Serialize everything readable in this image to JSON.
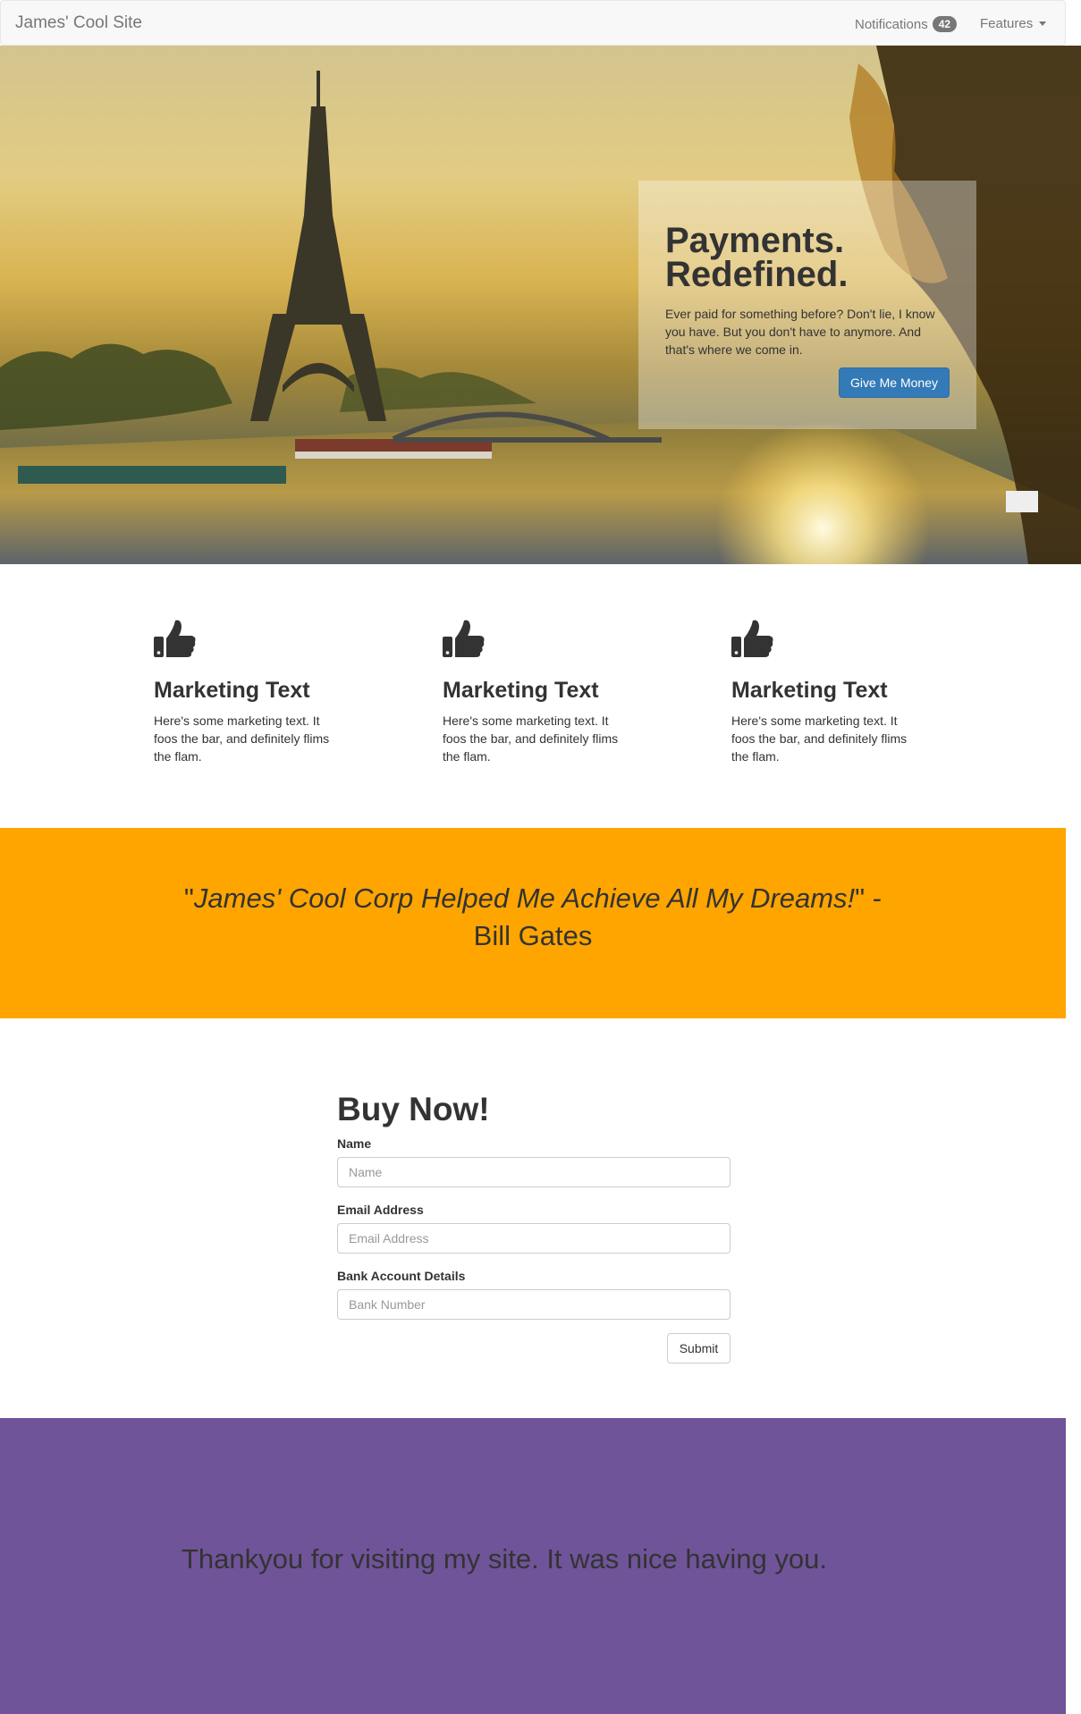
{
  "navbar": {
    "brand": "James' Cool Site",
    "notifications_label": "Notifications",
    "notifications_count": "42",
    "features_label": "Features"
  },
  "hero": {
    "title": "Payments. Redefined.",
    "text": "Ever paid for something before? Don't lie, I know you have. But you don't have to anymore. And that's where we come in.",
    "button_label": "Give Me Money"
  },
  "features": [
    {
      "icon": "thumbs-up-icon",
      "title": "Marketing Text",
      "text": "Here's some marketing text. It foos the bar, and definitely flims the flam."
    },
    {
      "icon": "thumbs-up-icon",
      "title": "Marketing Text",
      "text": "Here's some marketing text. It foos the bar, and definitely flims the flam."
    },
    {
      "icon": "thumbs-up-icon",
      "title": "Marketing Text",
      "text": "Here's some marketing text. It foos the bar, and definitely flims the flam."
    }
  ],
  "quote": {
    "open_quote": "\"",
    "text": "James' Cool Corp Helped Me Achieve All My Dreams!",
    "close_attribution": "\" - Bill Gates"
  },
  "form": {
    "title": "Buy Now!",
    "fields": [
      {
        "label": "Name",
        "placeholder": "Name",
        "value": ""
      },
      {
        "label": "Email Address",
        "placeholder": "Email Address",
        "value": ""
      },
      {
        "label": "Bank Account Details",
        "placeholder": "Bank Number",
        "value": ""
      }
    ],
    "submit_label": "Submit"
  },
  "footer": {
    "text": "Thankyou for visiting my site. It was nice having you."
  },
  "colors": {
    "navbar_bg": "#f8f8f8",
    "primary_button": "#337ab7",
    "quote_band": "#ffa500",
    "footer_band": "#6f5499",
    "text": "#333333"
  }
}
